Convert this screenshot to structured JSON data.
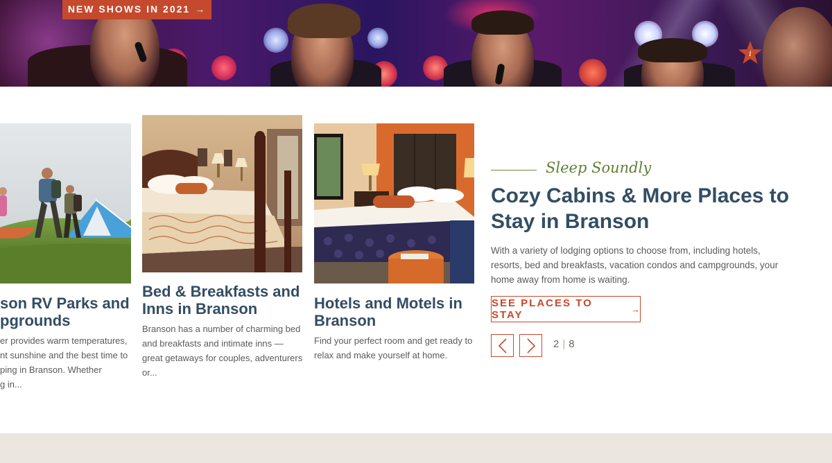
{
  "hero": {
    "badge_label": "NEW SHOWS IN 2021",
    "badge_arrow": "→",
    "info_icon_letter": "i"
  },
  "cards": [
    {
      "title_lines": [
        "son RV Parks and",
        "pgrounds"
      ],
      "desc_lines": [
        "er provides warm temperatures,",
        "nt sunshine and the best time to",
        "ping in Branson. Whether",
        "g in..."
      ]
    },
    {
      "title_lines": [
        "Bed & Breakfasts and",
        "Inns in Branson"
      ],
      "desc_lines": [
        "Branson has a number of charming bed",
        "and breakfasts and intimate inns —",
        "great getaways for couples, adventurers",
        "or..."
      ]
    },
    {
      "title_lines": [
        "Hotels and Motels in",
        "Branson"
      ],
      "desc_lines": [
        "Find your perfect room and get ready to",
        "relax and make yourself at home."
      ]
    }
  ],
  "feature": {
    "eyebrow": "Sleep Soundly",
    "title_lines": [
      "Cozy Cabins & More Places to",
      "Stay in Branson"
    ],
    "desc_lines": [
      "With a variety of lodging options to choose from, including hotels,",
      "resorts, bed and breakfasts, vacation condos and campgrounds, your",
      "home away from home is waiting."
    ],
    "cta_label": "SEE PLACES TO STAY",
    "cta_arrow": "→"
  },
  "pager": {
    "current": "2",
    "separator": "|",
    "total": "8"
  },
  "colors": {
    "accent": "#c5492c",
    "heading": "#334d63",
    "eyebrow": "#5f7f33",
    "footer": "#ebe6df"
  }
}
